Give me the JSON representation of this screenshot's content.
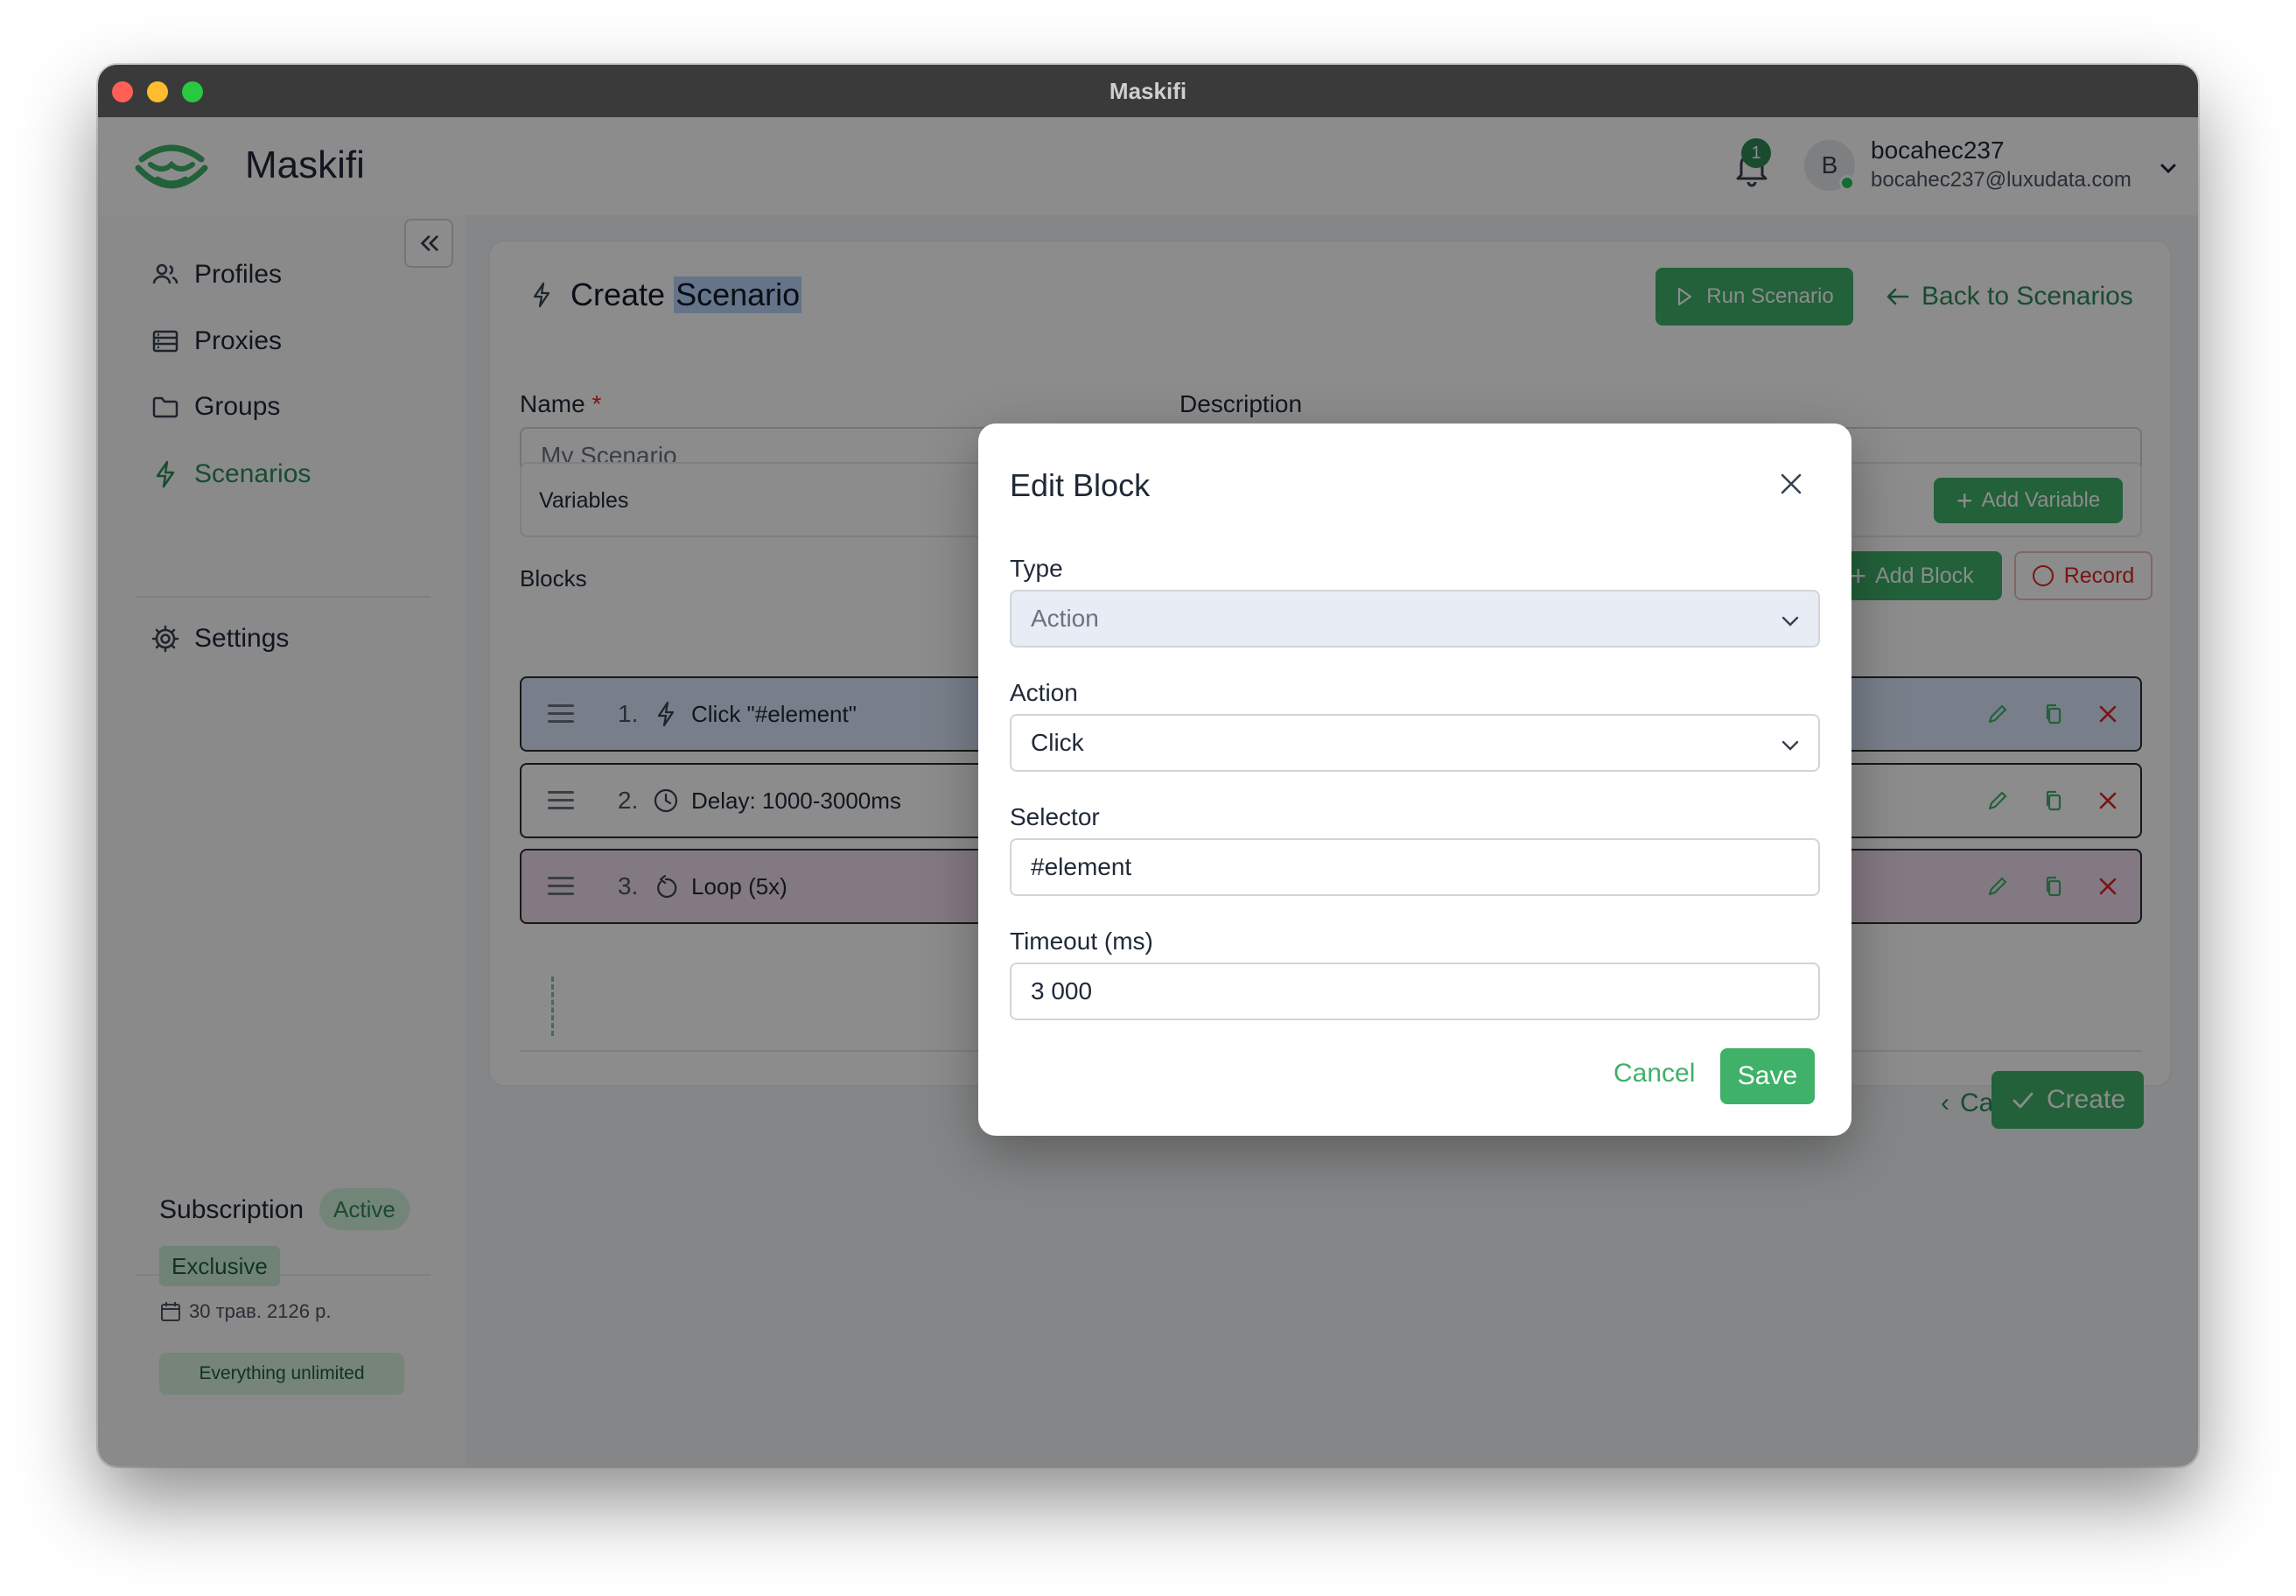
{
  "window": {
    "title": "Maskifi"
  },
  "header": {
    "brand": "Maskifi",
    "notification_count": "1",
    "user": {
      "initial": "B",
      "name": "bocahec237",
      "email": "bocahec237@luxudata.com"
    }
  },
  "sidebar": {
    "items": [
      {
        "label": "Profiles",
        "icon": "users-icon"
      },
      {
        "label": "Proxies",
        "icon": "server-icon"
      },
      {
        "label": "Groups",
        "icon": "folder-icon"
      },
      {
        "label": "Scenarios",
        "icon": "bolt-icon",
        "active": true
      }
    ],
    "settings_label": "Settings",
    "subscription": {
      "title": "Subscription",
      "status": "Active",
      "plan": "Exclusive",
      "expires": "30 трав. 2126 р.",
      "note": "Everything unlimited"
    }
  },
  "page": {
    "title_prefix": "Create ",
    "title_highlight": "Scenario",
    "run_label": "Run Scenario",
    "back_label": "Back to Scenarios",
    "name_label": "Name",
    "name_required": "*",
    "name_placeholder": "My Scenario",
    "description_label": "Description",
    "variables_label": "Variables",
    "add_variable_label": "Add Variable",
    "blocks_label": "Blocks",
    "add_block_label": "Add Block",
    "record_label": "Record",
    "blocks": [
      {
        "num": "1.",
        "icon": "bolt-icon",
        "text": "Click \"#element\"",
        "color": "#dbe7fb"
      },
      {
        "num": "2.",
        "icon": "clock-icon",
        "text": "Delay: 1000-3000ms",
        "color": "#ffffff"
      },
      {
        "num": "3.",
        "icon": "loop-icon",
        "text": "Loop (5x)",
        "color": "#efdcef"
      }
    ],
    "cancel_label": "Cancel",
    "create_label": "Create"
  },
  "modal": {
    "title": "Edit Block",
    "type_label": "Type",
    "type_value": "Action",
    "action_label": "Action",
    "action_value": "Click",
    "selector_label": "Selector",
    "selector_value": "#element",
    "timeout_label": "Timeout (ms)",
    "timeout_value": "3 000",
    "cancel_label": "Cancel",
    "save_label": "Save"
  },
  "colors": {
    "accent": "#3fb169",
    "accent_dark": "#2e8b57",
    "danger": "#dc2626"
  }
}
